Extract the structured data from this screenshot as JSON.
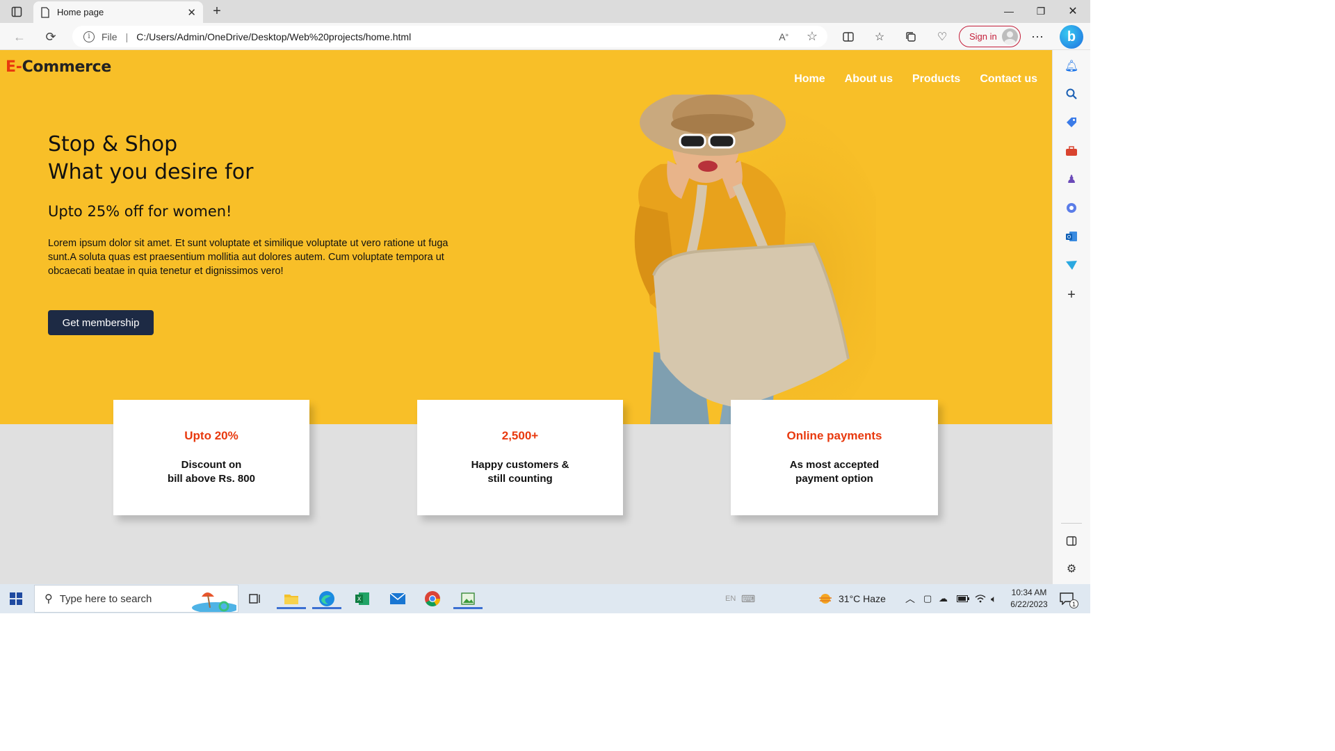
{
  "browser": {
    "tab_title": "Home page",
    "url": "C:/Users/Admin/OneDrive/Desktop/Web%20projects/home.html",
    "url_scheme_label": "File",
    "signin_label": "Sign in"
  },
  "site": {
    "logo_prefix": "E-",
    "logo_rest": "Commerce",
    "nav": [
      "Home",
      "About us",
      "Products",
      "Contact us"
    ],
    "headline_line1": "Stop & Shop",
    "headline_line2": "What you desire for",
    "subheadline": "Upto 25% off for women!",
    "paragraph": "Lorem ipsum dolor sit amet. Et sunt voluptate et similique voluptate ut vero ratione ut fuga sunt.A soluta quas est praesentium mollitia aut dolores autem. Cum voluptate tempora ut obcaecati beatae in quia tenetur et dignissimos vero!",
    "cta_label": "Get membership",
    "cards": [
      {
        "title": "Upto 20%",
        "line1": "Discount on",
        "line2": "bill above Rs. 800"
      },
      {
        "title": "2,500+",
        "line1": "Happy customers &",
        "line2": "still counting"
      },
      {
        "title": "Online payments",
        "line1": "As most accepted",
        "line2": "payment option"
      }
    ],
    "colors": {
      "hero_bg": "#f8bf28",
      "accent": "#e8390e",
      "button": "#1d2a44",
      "page_bg": "#e0e0e0"
    }
  },
  "taskbar": {
    "search_placeholder": "Type here to search",
    "weather": "31°C  Haze",
    "language": "EN",
    "time": "10:34 AM",
    "date": "6/22/2023",
    "notification_count": "1"
  }
}
